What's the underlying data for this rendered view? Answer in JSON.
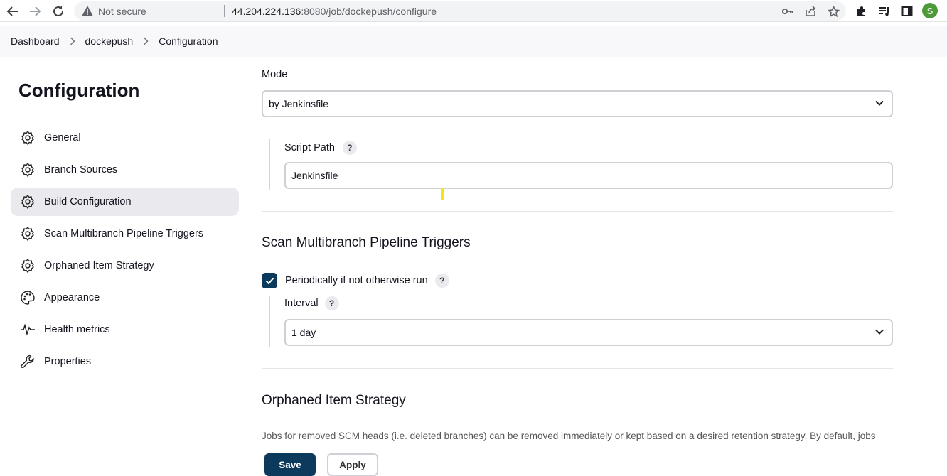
{
  "browser": {
    "security_label": "Not secure",
    "url_host": "44.204.224.136",
    "url_rest": ":8080/job/dockepush/configure",
    "avatar_letter": "S"
  },
  "breadcrumb": [
    "Dashboard",
    "dockepush",
    "Configuration"
  ],
  "sidebar": {
    "title": "Configuration",
    "items": [
      {
        "label": "General",
        "icon": "gear-icon"
      },
      {
        "label": "Branch Sources",
        "icon": "gear-icon"
      },
      {
        "label": "Build Configuration",
        "icon": "gear-icon",
        "active": true
      },
      {
        "label": "Scan Multibranch Pipeline Triggers",
        "icon": "gear-icon"
      },
      {
        "label": "Orphaned Item Strategy",
        "icon": "gear-icon"
      },
      {
        "label": "Appearance",
        "icon": "palette-icon"
      },
      {
        "label": "Health metrics",
        "icon": "pulse-icon"
      },
      {
        "label": "Properties",
        "icon": "wrench-icon"
      }
    ]
  },
  "build_config": {
    "mode_label": "Mode",
    "mode_value": "by Jenkinsfile",
    "script_path_label": "Script Path",
    "script_path_value": "Jenkinsfile"
  },
  "triggers": {
    "title": "Scan Multibranch Pipeline Triggers",
    "periodic_label": "Periodically if not otherwise run",
    "periodic_checked": true,
    "interval_label": "Interval",
    "interval_value": "1 day"
  },
  "orphaned": {
    "title": "Orphaned Item Strategy",
    "description": "Jobs for removed SCM heads (i.e. deleted branches) can be removed immediately or kept based on a desired retention strategy. By default, jobs"
  },
  "help_glyph": "?",
  "actions": {
    "save": "Save",
    "apply": "Apply"
  },
  "colors": {
    "primary_button": "#0b3a5c",
    "active_nav": "#eaeaee",
    "highlight": "#f5e50a"
  }
}
